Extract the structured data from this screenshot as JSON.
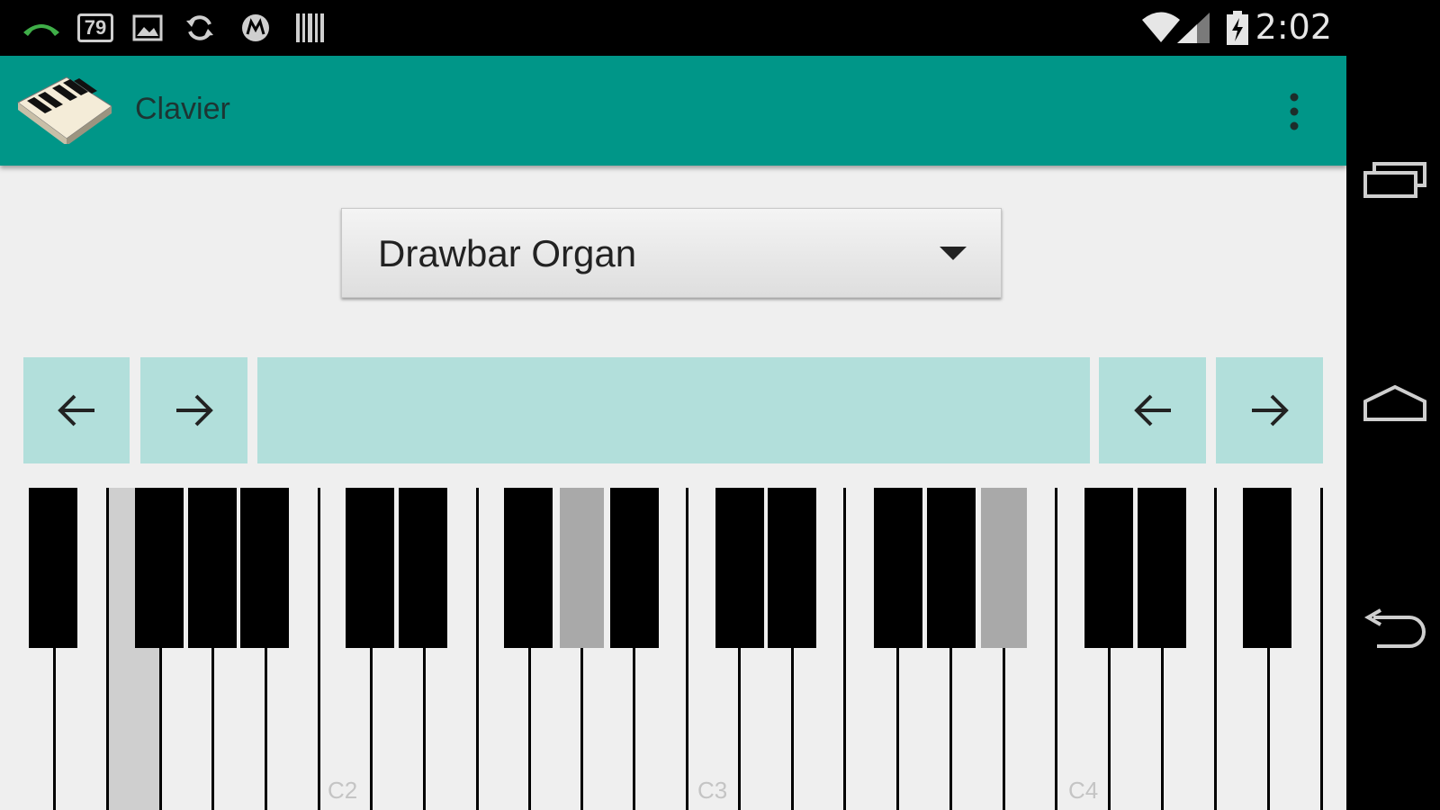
{
  "status_bar": {
    "badge_number": "79",
    "time": "2:02",
    "icons": [
      "call-active-icon",
      "notification-badge-icon",
      "gallery-icon",
      "sync-icon",
      "motorola-icon",
      "barcode-icon",
      "wifi-icon",
      "cell-signal-icon",
      "battery-charging-icon"
    ]
  },
  "action_bar": {
    "title": "Clavier",
    "logo_icon": "piano-app-icon",
    "menu_icon": "overflow-menu-icon"
  },
  "instrument_selector": {
    "selected": "Drawbar Organ",
    "arrow_icon": "dropdown-arrow-icon"
  },
  "navigation": {
    "left_group": [
      "arrow-left-icon",
      "arrow-right-icon"
    ],
    "right_group": [
      "arrow-left-icon",
      "arrow-right-icon"
    ]
  },
  "keyboard": {
    "octave_labels": [
      "C2",
      "C3",
      "C4"
    ],
    "pressed_keys": [
      "white-2",
      "black-7",
      "black-14"
    ]
  },
  "system_nav": {
    "icons": [
      "recent-apps-icon",
      "home-icon",
      "back-icon"
    ]
  },
  "colors": {
    "primary": "#009688",
    "accent_light": "#b2dfdb",
    "background": "#efefef",
    "pressed_gray": "#a9a9a9"
  }
}
